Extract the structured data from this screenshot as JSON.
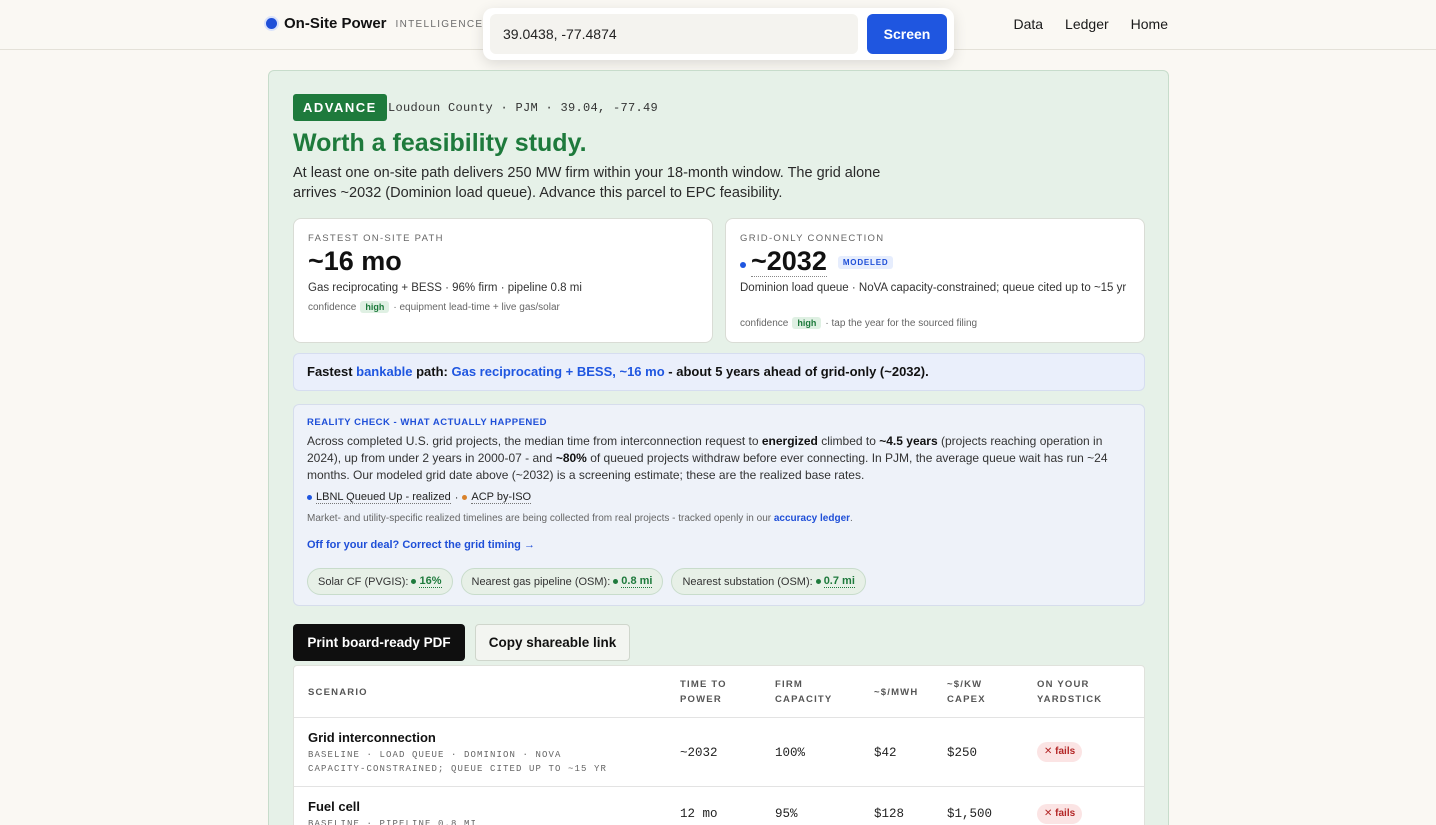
{
  "brand": {
    "name": "On-Site Power",
    "sub": "INTELLIGENCE"
  },
  "search": {
    "value": "39.0438, -77.4874",
    "button": "Screen"
  },
  "nav": [
    "Data",
    "Ledger",
    "Home"
  ],
  "verdict": {
    "badge": "ADVANCE",
    "meta": "Loudoun County · PJM · 39.04, -77.49",
    "headline": "Worth a feasibility study.",
    "summary": "At least one on-site path delivers 250 MW firm within your 18-month window. The grid alone arrives ~2032 (Dominion load queue). Advance this parcel to EPC feasibility."
  },
  "fastest_onsite": {
    "label": "FASTEST ON-SITE PATH",
    "value": "~16 mo",
    "desc": "Gas reciprocating + BESS · 96% firm · pipeline 0.8 mi",
    "conf_label": "confidence",
    "conf": "high",
    "conf_note": "· equipment lead-time + live gas/solar"
  },
  "grid_only": {
    "label": "GRID-ONLY CONNECTION",
    "value": "~2032",
    "badge": "MODELED",
    "desc": "Dominion load queue · NoVA capacity-constrained; queue cited up to ~15 yr",
    "conf_label": "confidence",
    "conf": "high",
    "conf_note": "· tap the year for the sourced filing"
  },
  "fastest_path": {
    "p1": "Fastest ",
    "bankable": "bankable",
    "p2": " path: ",
    "path": "Gas reciprocating + BESS, ~16 mo",
    "p3": " - about 5 years ahead of grid-only (~2032)."
  },
  "reality": {
    "title": "REALITY CHECK - WHAT ACTUALLY HAPPENED",
    "t1": "Across completed U.S. grid projects, the median time from interconnection request to ",
    "b1": "energized",
    "t2": " climbed to ",
    "b2": "~4.5 years",
    "t3": " (projects reaching operation in 2024), up from under 2 years in 2000-07 - and ",
    "b3": "~80%",
    "t4": " of queued projects withdraw before ever connecting. In PJM, the average queue wait has run ~24 months. Our modeled grid date above (~2032) is a screening estimate; these are the realized base rates.",
    "source1": "LBNL Queued Up - realized",
    "source2": "ACP by-ISO",
    "sep": "·",
    "note": "Market- and utility-specific realized timelines are being collected from real projects - tracked openly in our ",
    "note_link": "accuracy ledger",
    "note_end": ".",
    "correct": "Off for your deal? Correct the grid timing →",
    "chips": [
      {
        "label": "Solar CF (PVGIS):",
        "value": "16%"
      },
      {
        "label": "Nearest gas pipeline (OSM):",
        "value": "0.8 mi"
      },
      {
        "label": "Nearest substation (OSM):",
        "value": "0.7 mi"
      }
    ]
  },
  "actions": {
    "pdf": "Print board-ready PDF",
    "copy": "Copy shareable link"
  },
  "table": {
    "headers": [
      "SCENARIO",
      "TIME TO POWER",
      "FIRM CAPACITY",
      "~$/MWH",
      "~$/KW CAPEX",
      "ON YOUR YARDSTICK"
    ],
    "rows": [
      {
        "name": "Grid interconnection",
        "sub": "BASELINE · LOAD QUEUE · DOMINION · NOVA CAPACITY-CONSTRAINED; QUEUE CITED UP TO ~15 YR",
        "time": "~2032",
        "firm": "100%",
        "mwh": "$42",
        "capex": "$250",
        "status": "✕ fails"
      },
      {
        "name": "Fuel cell",
        "sub": "BASELINE · PIPELINE 0.8 MI",
        "time": "12 mo",
        "firm": "95%",
        "mwh": "$128",
        "capex": "$1,500",
        "status": "✕ fails"
      }
    ]
  },
  "colors": {
    "accent_green": "#1e7a3c",
    "accent_blue": "#1f56e0",
    "fail_red": "#b32626"
  }
}
